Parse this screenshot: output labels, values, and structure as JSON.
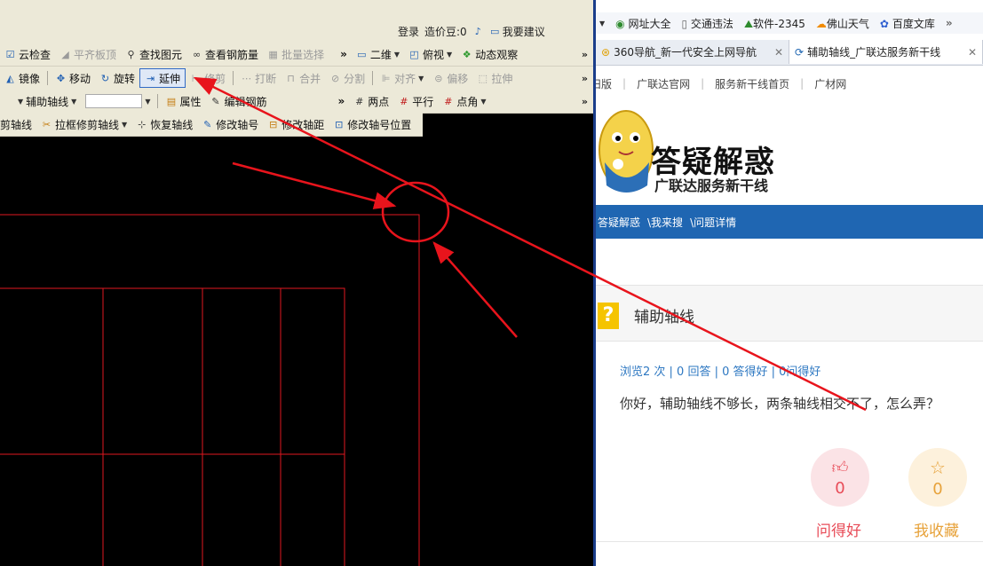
{
  "cad": {
    "login": {
      "login_label": "登录",
      "beans_label": "造价豆:0",
      "suggest_label": "我要建议"
    },
    "toolbar1": {
      "items": [
        "云检查",
        "平齐板顶",
        "查找图元",
        "查看钢筋量",
        "批量选择"
      ],
      "view2d": "二维",
      "view_top": "俯视",
      "dynamic": "动态观察"
    },
    "toolbar2": {
      "items": [
        "镜像",
        "移动",
        "旋转",
        "延伸",
        "修剪",
        "打断",
        "合并",
        "分割",
        "对齐",
        "偏移",
        "拉伸"
      ],
      "active": "延伸"
    },
    "toolbar3": {
      "axis_type": "辅助轴线",
      "combo_value": "",
      "items": [
        "属性",
        "编辑钢筋",
        "两点",
        "平行",
        "点角"
      ]
    },
    "toolbar4": {
      "items": [
        "剪轴线",
        "拉框修剪轴线",
        "恢复轴线",
        "修改轴号",
        "修改轴距",
        "修改轴号位置"
      ]
    },
    "colors": {
      "axis": "#e0171f",
      "canvas": "#000000"
    }
  },
  "browser": {
    "favorites": [
      "网址大全",
      "交通违法",
      "软件-2345",
      "佛山天气",
      "百度文库"
    ],
    "tabs": [
      {
        "title": "360导航_新一代安全上网导航",
        "active": false
      },
      {
        "title": "辅助轴线_广联达服务新干线",
        "active": true
      }
    ],
    "site_nav": [
      "旧版",
      "广联达官网",
      "服务新干线首页",
      "广材网"
    ],
    "logo": {
      "title": "答疑解惑",
      "subtitle": "广联达服务新干线"
    },
    "breadcrumb": [
      "答疑解惑",
      "\\我来搜",
      "\\问题详情"
    ],
    "question": {
      "title": "辅助轴线",
      "stats": "浏览2 次 | 0 回答 | 0 答得好 | 0问得好",
      "text": "你好，辅助轴线不够长，两条轴线相交不了，怎么弄？"
    },
    "actions": {
      "like": {
        "count": "0",
        "label": "问得好",
        "color": "#e84c58"
      },
      "fav": {
        "count": "0",
        "label": "我收藏",
        "color": "#e7a23a"
      }
    }
  },
  "annotation_color": "#e8141c"
}
